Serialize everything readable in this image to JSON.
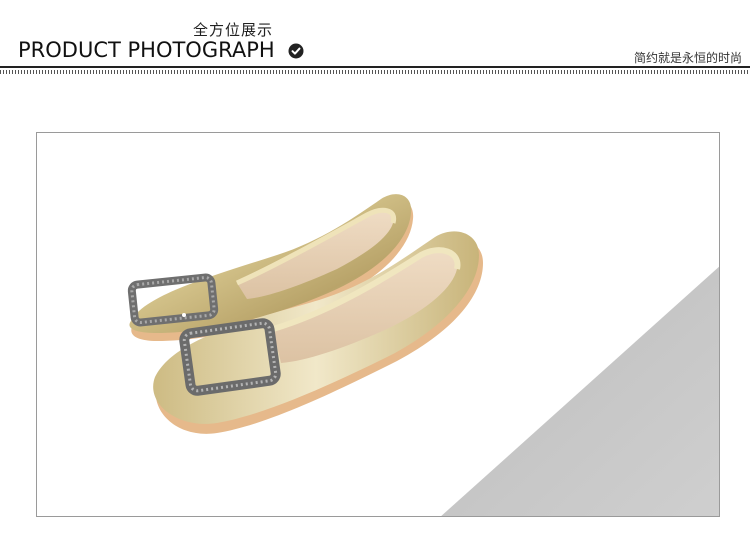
{
  "header": {
    "subtitle_cn": "全方位展示",
    "title_en": "PRODUCT PHOTOGRAPH",
    "slogan": "简约就是永恒的时尚",
    "check_icon": "check-circle-icon"
  },
  "photo": {
    "subject": "gold-flat-shoes",
    "accent_gray": "#c3c3c3",
    "shoe_gold": "#d8c88f",
    "sole_color": "#e9b98a"
  }
}
